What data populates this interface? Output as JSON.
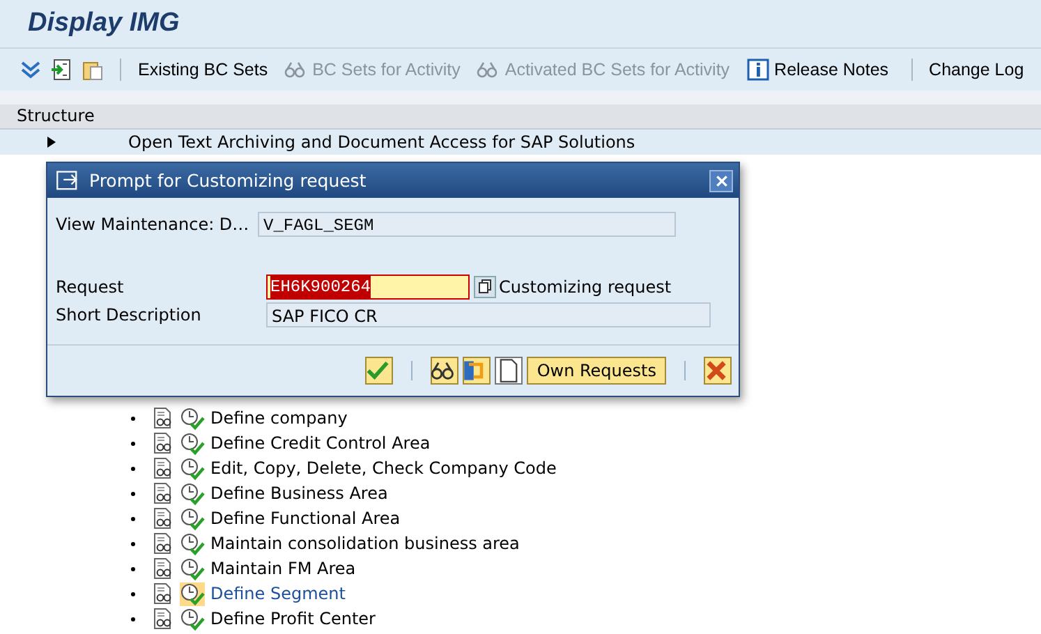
{
  "window": {
    "title": "Display IMG"
  },
  "toolbar": [
    {
      "kind": "icon"
    },
    {
      "kind": "icon"
    },
    {
      "kind": "icon"
    },
    {
      "kind": "sep"
    },
    {
      "kind": "text",
      "label": "Existing BC Sets",
      "disabled": false
    },
    {
      "kind": "text",
      "label": "BC Sets for Activity",
      "disabled": true
    },
    {
      "kind": "text",
      "label": "Activated BC Sets for Activity",
      "disabled": true
    },
    {
      "kind": "text",
      "label": "Release Notes",
      "disabled": false
    },
    {
      "kind": "sep"
    },
    {
      "kind": "text",
      "label": "Change Log",
      "disabled": false
    }
  ],
  "structure": {
    "header": "Structure",
    "items": [
      {
        "label": "Open Text Archiving and Document Access for SAP Solutions",
        "expanded": false
      },
      {
        "children": [
          {
            "label": "Define company",
            "selected": false
          },
          {
            "label": "Define Credit Control Area",
            "selected": false
          },
          {
            "label": "Edit, Copy, Delete, Check Company Code",
            "selected": false
          },
          {
            "label": "Define Business Area",
            "selected": false
          },
          {
            "label": "Define Functional Area",
            "selected": false
          },
          {
            "label": "Maintain consolidation business area",
            "selected": false
          },
          {
            "label": "Maintain FM Area",
            "selected": false
          },
          {
            "label": "Define Segment",
            "selected": true
          },
          {
            "label": "Define Profit Center",
            "selected": false
          }
        ]
      }
    ]
  },
  "dialog": {
    "title": "Prompt for Customizing request",
    "view_label": "View Maintenance: D…",
    "view_value": "V_FAGL_SEGM",
    "request_label": "Request",
    "request_value": "EH6K900264",
    "request_type": "Customizing request",
    "description_label": "Short Description",
    "description_value": "SAP FICO CR",
    "own_requests": "Own Requests"
  }
}
